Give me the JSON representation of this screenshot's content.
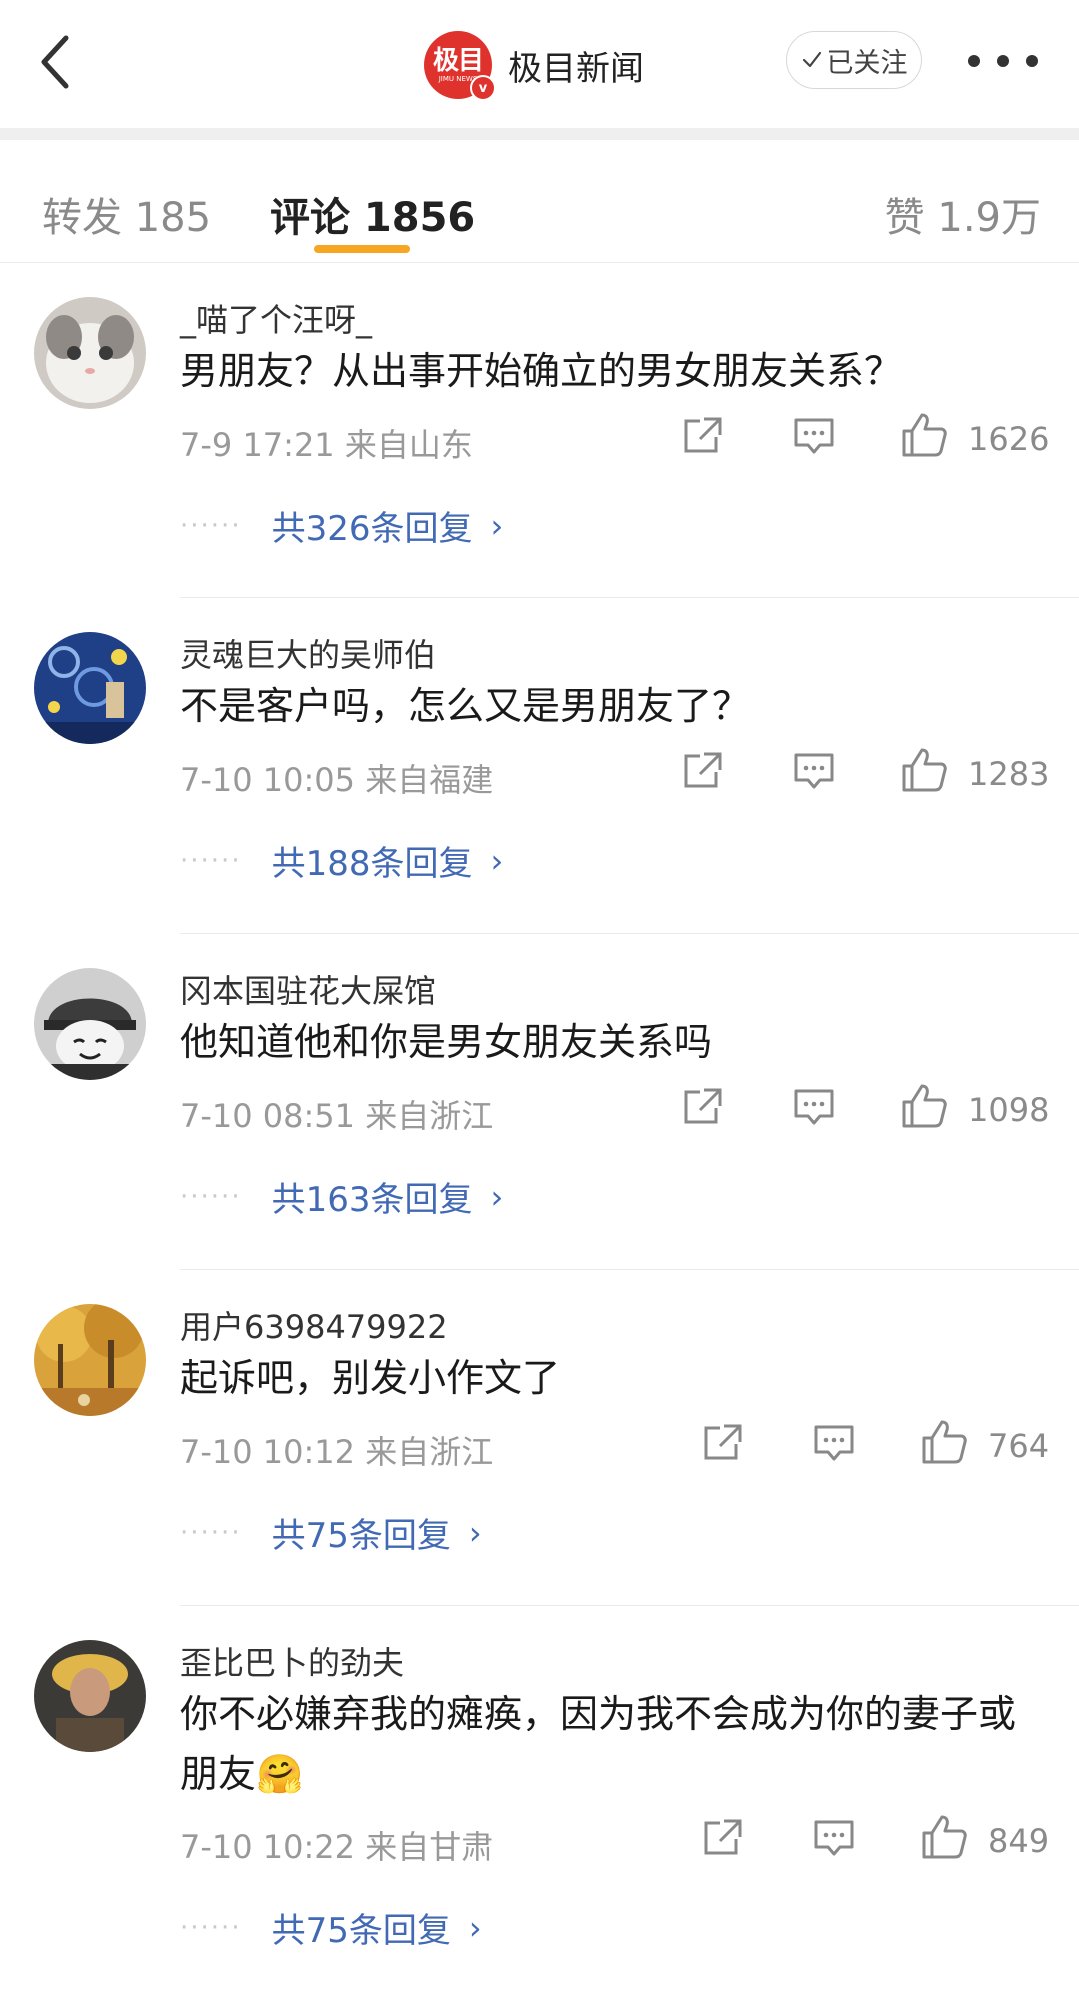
{
  "header": {
    "account_name": "极目新闻",
    "logo_text": "极目",
    "logo_subtext": "JIMU NEWS",
    "follow_label": "已关注",
    "brand_color": "#e0322c"
  },
  "tabs": {
    "repost": "转发 185",
    "comment": "评论 1856",
    "like": "赞 1.9万",
    "indicator_color": "#f6a623"
  },
  "comments": [
    {
      "user": "_喵了个汪呀_",
      "text": "男朋友？从出事开始确立的男女朋友关系？",
      "meta": "7-9 17:21  来自山东",
      "likes": "1626",
      "replies": "共326条回复"
    },
    {
      "user": "灵魂巨大的吴师伯",
      "text": "不是客户吗，怎么又是男朋友了？",
      "meta": "7-10 10:05  来自福建",
      "likes": "1283",
      "replies": "共188条回复"
    },
    {
      "user": "冈本国驻花大屎馆",
      "text": "他知道他和你是男女朋友关系吗",
      "meta": "7-10 08:51  来自浙江",
      "likes": "1098",
      "replies": "共163条回复"
    },
    {
      "user": "用户6398479922",
      "text": "起诉吧，别发小作文了",
      "meta": "7-10 10:12  来自浙江",
      "likes": "764",
      "replies": "共75条回复"
    },
    {
      "user": "歪比巴卜的劲夫",
      "text": "你不必嫌弃我的瘫痪，因为我不会成为你的妻子或朋友🤗",
      "meta": "7-10 10:22  来自甘肃",
      "likes": "849",
      "replies": "共75条回复"
    }
  ],
  "icons": [
    "back-arrow-icon",
    "check-icon",
    "more-icon",
    "share-icon",
    "comment-icon",
    "like-icon",
    "chevron-right-icon"
  ]
}
